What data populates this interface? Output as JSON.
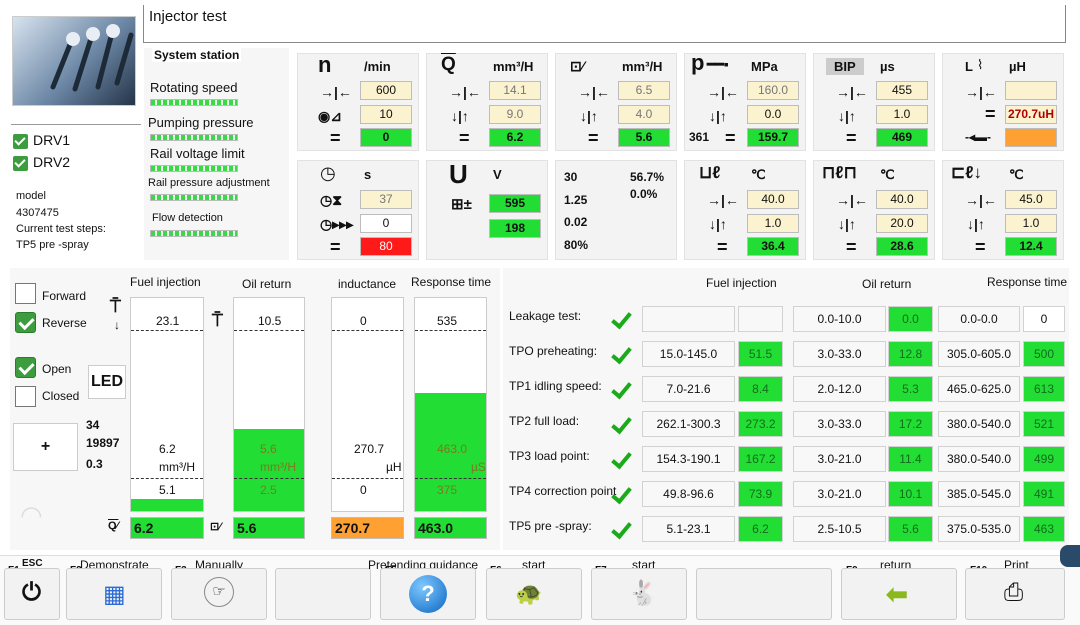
{
  "header": {
    "title": "Injector test"
  },
  "drv": [
    {
      "label": "DRV1"
    },
    {
      "label": "DRV2"
    }
  ],
  "info": {
    "model_label": "model",
    "model": "4307475",
    "steps_label": "Current test steps:",
    "step": "TP5 pre -spray"
  },
  "system": {
    "title": "System station",
    "items": [
      "Rotating speed",
      "Pumping pressure",
      "Rail voltage limit",
      "Rail pressure adjustment",
      "Flow detection"
    ]
  },
  "speed": {
    "symbol": "n",
    "unit": "/min",
    "set": "600",
    "tol": "10",
    "act": "0"
  },
  "qinj": {
    "unit": "mm³/H",
    "set": "14.1",
    "tol": "9.0",
    "act": "6.2"
  },
  "qret": {
    "unit": "mm³/H",
    "set": "6.5",
    "tol": "4.0",
    "act": "5.6"
  },
  "press": {
    "symbol": "p",
    "unit": "MPa",
    "set": "160.0",
    "tol": "0.0",
    "act": "159.7",
    "extra": "361"
  },
  "bip": {
    "badge": "BIP",
    "unit": "µs",
    "set": "455",
    "tol": "1.0",
    "act": "469"
  },
  "induct": {
    "symbol": "L",
    "unit": "µH",
    "set": "",
    "act": "270.7uH"
  },
  "time": {
    "unit": "s",
    "set": "37",
    "tol": "0",
    "act": "80"
  },
  "volt": {
    "symbol": "U",
    "unit": "V",
    "v1": "595",
    "v2": "198"
  },
  "stats": {
    "a1": "30",
    "a2": "56.7%",
    "b1": "1.25",
    "b2": "0.0%",
    "c1": "0.02",
    "d1": "80%"
  },
  "temp1": {
    "unit": "℃",
    "set": "40.0",
    "tol": "1.0",
    "act": "36.4"
  },
  "temp2": {
    "unit": "℃",
    "set": "40.0",
    "tol": "20.0",
    "act": "28.6"
  },
  "temp3": {
    "unit": "℃",
    "set": "45.0",
    "tol": "1.0",
    "act": "12.4"
  },
  "flow": {
    "forward": "Forward",
    "reverse": "Reverse",
    "open": "Open",
    "closed": "Closed",
    "led": "LED",
    "plus": "+",
    "n1": "34",
    "n2": "19897",
    "n3": "0.3"
  },
  "bars": {
    "headers": [
      "Fuel injection",
      "Oil return",
      "inductance",
      "Response time"
    ],
    "fuel": {
      "top": "23.1",
      "mid": "6.2",
      "unit": "mm³/H",
      "bot": "5.1",
      "fill": 0.05
    },
    "oil": {
      "top": "10.5",
      "mid": "5.6",
      "unit": "mm³/H",
      "bot": "2.5",
      "fill": 0.47
    },
    "ind": {
      "top": "0",
      "mid": "270.7",
      "unit": "µH",
      "bot": "0",
      "fill": 0
    },
    "resp": {
      "top": "535",
      "mid": "463.0",
      "unit": "µS",
      "bot": "375",
      "fill": 0.75
    },
    "foot": [
      "6.2",
      "5.6",
      "270.7",
      "463.0"
    ]
  },
  "results": {
    "headers": [
      "Fuel injection",
      "Oil return",
      "Response time"
    ],
    "rows": [
      {
        "name": "Leakage test:",
        "f": "",
        "fv": "",
        "o": "0.0-10.0",
        "ov": "0.0",
        "r": "0.0-0.0",
        "rv": "0"
      },
      {
        "name": "TPO preheating:",
        "f": "15.0-145.0",
        "fv": "51.5",
        "o": "3.0-33.0",
        "ov": "12.8",
        "r": "305.0-605.0",
        "rv": "500"
      },
      {
        "name": "TP1 idling speed:",
        "f": "7.0-21.6",
        "fv": "8.4",
        "o": "2.0-12.0",
        "ov": "5.3",
        "r": "465.0-625.0",
        "rv": "613"
      },
      {
        "name": "TP2 full load:",
        "f": "262.1-300.3",
        "fv": "273.2",
        "o": "3.0-33.0",
        "ov": "17.2",
        "r": "380.0-540.0",
        "rv": "521"
      },
      {
        "name": "TP3 load point:",
        "f": "154.3-190.1",
        "fv": "167.2",
        "o": "3.0-21.0",
        "ov": "11.4",
        "r": "380.0-540.0",
        "rv": "499"
      },
      {
        "name": "TP4 correction point",
        "f": "49.8-96.6",
        "fv": "73.9",
        "o": "3.0-21.0",
        "ov": "10.1",
        "r": "385.0-545.0",
        "rv": "491"
      },
      {
        "name": "TP5 pre -spray:",
        "f": "5.1-23.1",
        "fv": "6.2",
        "o": "2.5-10.5",
        "ov": "5.6",
        "r": "375.0-535.0",
        "rv": "463"
      }
    ]
  },
  "fkeys": [
    {
      "key": "F1",
      "label": "ESC"
    },
    {
      "key": "F2",
      "label": "Demonstrate"
    },
    {
      "key": "F3",
      "label": "Manually"
    },
    {
      "key": "F5",
      "label": "Pretending guidance"
    },
    {
      "key": "F6",
      "label": "start"
    },
    {
      "key": "F7",
      "label": "start"
    },
    {
      "key": "F9",
      "label": "return"
    },
    {
      "key": "F10",
      "label": "Print"
    }
  ]
}
